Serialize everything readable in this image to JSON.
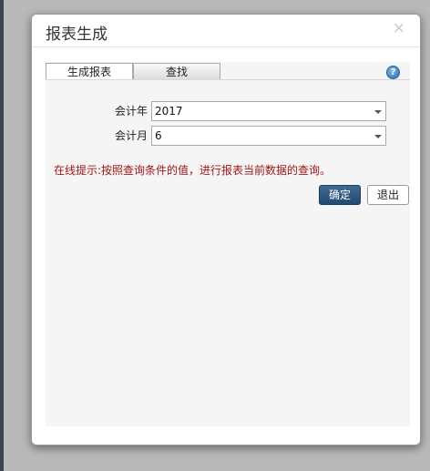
{
  "dialog": {
    "title": "报表生成",
    "close_symbol": "×"
  },
  "tabs": [
    {
      "label": "生成报表",
      "active": true
    },
    {
      "label": "查找",
      "active": false
    }
  ],
  "help_icon": "question-circle-icon",
  "help_symbol": "?",
  "form": {
    "year": {
      "label": "会计年",
      "value": "2017"
    },
    "month": {
      "label": "会计月",
      "value": "6"
    }
  },
  "hint": "在线提示:按照查询条件的值，进行报表当前数据的查询。",
  "buttons": {
    "confirm": "确定",
    "exit": "退出"
  },
  "colors": {
    "hint": "#a01818",
    "confirm_button": "#2f5a84"
  }
}
